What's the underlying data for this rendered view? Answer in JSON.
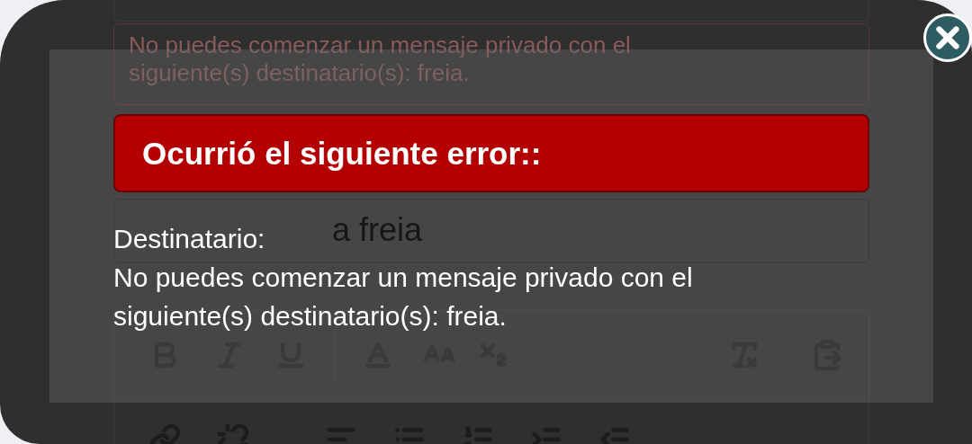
{
  "background_form": {
    "error_notice": "No puedes comenzar un mensaje privado con el siguiente(s) destinatario(s): freia.",
    "subject_field": {
      "value": "a freia"
    }
  },
  "dialog": {
    "title": "Ocurrió el siguiente error::",
    "field_label": "Destinatario:",
    "message": "No puedes comenzar un mensaje privado con el siguiente(s) destinatario(s): freia."
  }
}
